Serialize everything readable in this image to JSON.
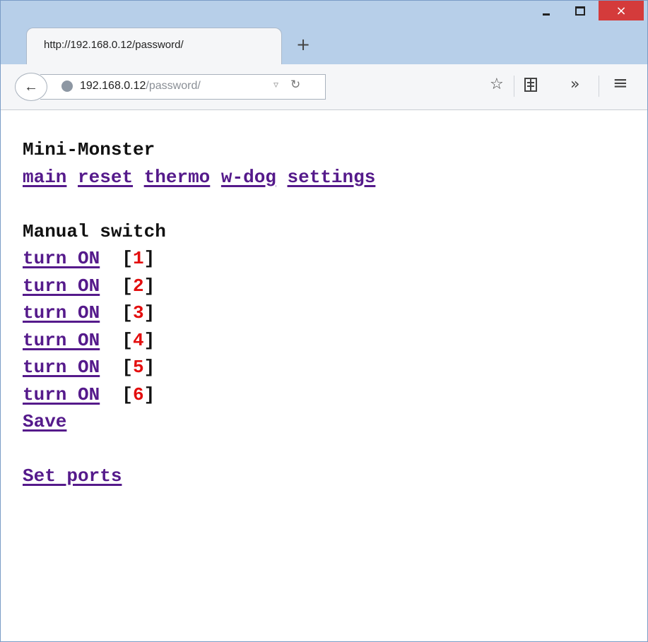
{
  "browser": {
    "tab_title": "http://192.168.0.12/password/",
    "new_tab": "+",
    "url_host": "192.168.0.12",
    "url_path": "/password/",
    "window_controls": {
      "minimize": "minimize-icon",
      "maximize": "maximize-icon",
      "close": "×"
    },
    "toolbar_icons": {
      "back": "←",
      "bookmark": "☆",
      "reader": "reader-icon",
      "overflow": "»",
      "menu": "≡"
    }
  },
  "page": {
    "title": "Mini-Monster",
    "nav": [
      "main",
      "reset",
      "thermo",
      "w-dog",
      "settings"
    ],
    "section_title": "Manual switch",
    "switches": [
      {
        "action": "turn ON",
        "number": "1"
      },
      {
        "action": "turn ON",
        "number": "2"
      },
      {
        "action": "turn ON",
        "number": "3"
      },
      {
        "action": "turn ON",
        "number": "4"
      },
      {
        "action": "turn ON",
        "number": "5"
      },
      {
        "action": "turn ON",
        "number": "6"
      }
    ],
    "save": "Save",
    "set_ports": "Set ports"
  },
  "colors": {
    "link": "#551a8b",
    "number": "#e30e0e",
    "titlebar": "#b7cfe9",
    "close_button": "#d43b3b"
  }
}
